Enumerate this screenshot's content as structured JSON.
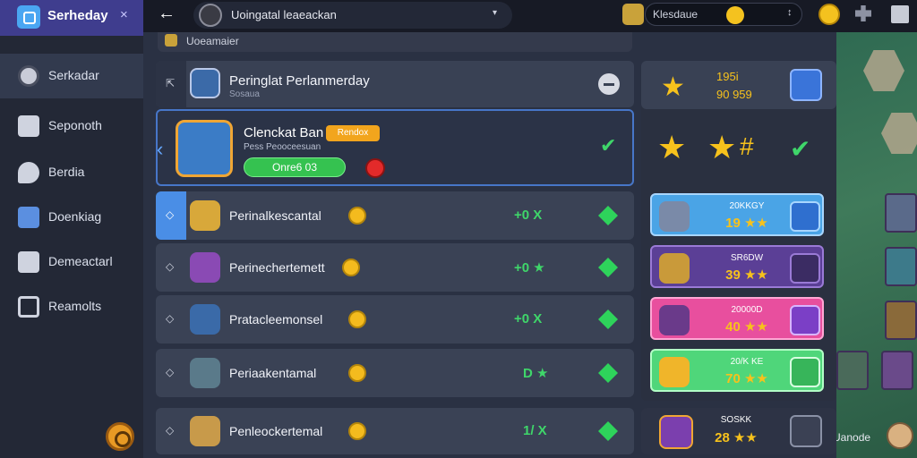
{
  "sidebar": {
    "title": "Serheday",
    "close": "×",
    "items": [
      {
        "label": "Serkadar",
        "icon": "profile-icon"
      },
      {
        "label": "Seponoth",
        "icon": "inbox-icon"
      },
      {
        "label": "Berdia",
        "icon": "chat-icon"
      },
      {
        "label": "Doenkiag",
        "icon": "flag-icon"
      },
      {
        "label": "Demeactarl",
        "icon": "person-icon"
      },
      {
        "label": "Reamolts",
        "icon": "monitor-icon"
      }
    ],
    "settings_icon": "gear-icon"
  },
  "topbar": {
    "back": "←",
    "player_name": "Uoingatal leaeackan",
    "caret": "▾",
    "search_text": "Klesdaue",
    "search_caret": "↕"
  },
  "section_label": "Uoeamaier",
  "header_row": {
    "title": "Peringlat Perlanmerday",
    "subtitle": "Sosaua"
  },
  "featured": {
    "title": "Clenckat Ban",
    "badge": "Rendox",
    "subtitle": "Pess Peooceesuan",
    "button": "Onre6 03"
  },
  "rows": [
    {
      "name": "Perinalkescantal",
      "score": "+0 X",
      "nav": "◇"
    },
    {
      "name": "Perinechertemett",
      "score": "+0 ★",
      "nav": "◇"
    },
    {
      "name": "Pratacleemonsel",
      "score": "+0 X",
      "nav": "◇"
    },
    {
      "name": "Periaakentamal",
      "score": "D ★",
      "nav": "◇"
    },
    {
      "name": "Penleockertemal",
      "score": "1/ X",
      "nav": "◇"
    }
  ],
  "right_head": {
    "line1": "195i",
    "line2": "90 959"
  },
  "right_stars_check": "✔",
  "cards": [
    {
      "name": "20KKGY",
      "value": "19 ★★",
      "bg": "#4aa4e6",
      "btn": "#2f6fcf"
    },
    {
      "name": "SR6DW",
      "value": "39 ★★",
      "bg": "#5b3f96",
      "btn": "#3b2c63"
    },
    {
      "name": "20000D",
      "value": "40 ★★",
      "bg": "#e84f9e",
      "btn": "#7b3fc6"
    },
    {
      "name": "20/K KE",
      "value": "70 ★★",
      "bg": "#4fd67a",
      "btn": "#37b55a"
    }
  ],
  "foot_card": {
    "name": "SOSKK",
    "value": "28 ★★"
  },
  "bg_caption": "Uanode",
  "colors": {
    "accent": "#3fd66a",
    "gold": "#f7c21c",
    "sidebar_header": "#3f3d8e"
  }
}
